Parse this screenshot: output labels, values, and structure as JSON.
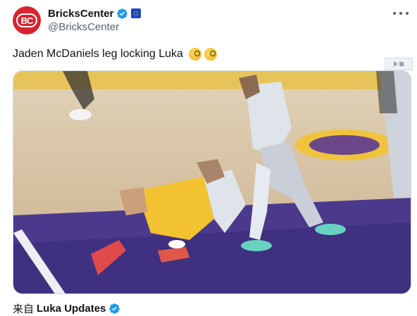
{
  "author": {
    "display_name": "BricksCenter",
    "handle": "@BricksCenter",
    "avatar_text": "BC",
    "verified_icon": "verified-badge-icon",
    "affiliate_icon": "eu-flag-icon"
  },
  "tweet": {
    "text": "Jaden McDaniels leg locking Luka",
    "emojis": [
      "face-with-monocle",
      "face-with-monocle"
    ]
  },
  "footer": {
    "prefix": "来自",
    "source": "Luka Updates"
  },
  "colors": {
    "brand_red": "#d9232e",
    "verified_blue": "#1d9bf0",
    "text_primary": "#0f1419",
    "text_secondary": "#536471",
    "court_purple": "#4b3a8c",
    "lakers_gold": "#f2c230"
  }
}
